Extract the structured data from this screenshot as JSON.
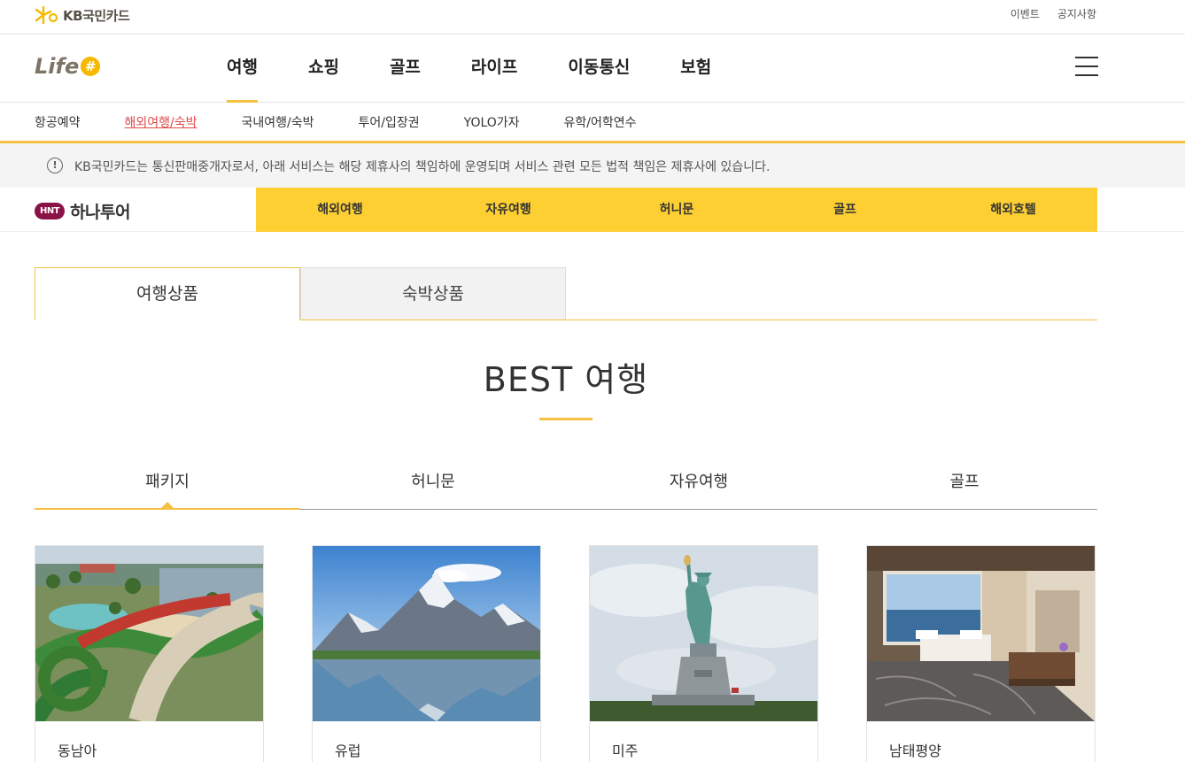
{
  "topbar": {
    "brand": "KB국민카드",
    "links": [
      "이벤트",
      "공지사항"
    ]
  },
  "header": {
    "logo": "Life",
    "logo_mark": "#",
    "nav": [
      "여행",
      "쇼핑",
      "골프",
      "라이프",
      "이동통신",
      "보험"
    ],
    "active_nav": "여행"
  },
  "subnav": {
    "items": [
      "항공예약",
      "해외여행/숙박",
      "국내여행/숙박",
      "투어/입장권",
      "YOLO가자",
      "유학/어학연수"
    ],
    "active": "해외여행/숙박"
  },
  "notice": {
    "icon": "!",
    "text": "KB국민카드는 통신판매중개자로서, 아래 서비스는 해당 제휴사의 책임하에 운영되며 서비스 관련 모든 법적 책임은 제휴사에 있습니다."
  },
  "partner": {
    "badge": "HNT",
    "name": "하나투어",
    "menu": [
      "해외여행",
      "자유여행",
      "허니문",
      "골프",
      "해외호텔"
    ]
  },
  "product_tabs": {
    "active": "여행상품",
    "inactive": "숙박상품"
  },
  "best": {
    "title": "BEST 여행"
  },
  "categories": {
    "items": [
      "패키지",
      "허니문",
      "자유여행",
      "골프"
    ],
    "active": "패키지"
  },
  "cards": [
    {
      "label": "동남아",
      "image": "waterpark-resort"
    },
    {
      "label": "유럽",
      "image": "alpine-lake"
    },
    {
      "label": "미주",
      "image": "statue-of-liberty"
    },
    {
      "label": "남태평양",
      "image": "hotel-room"
    }
  ],
  "colors": {
    "accent": "#f6c142",
    "partner_bar": "#fdcf33",
    "hana_brand": "#8a1246",
    "active_sub": "#e04a4a"
  }
}
